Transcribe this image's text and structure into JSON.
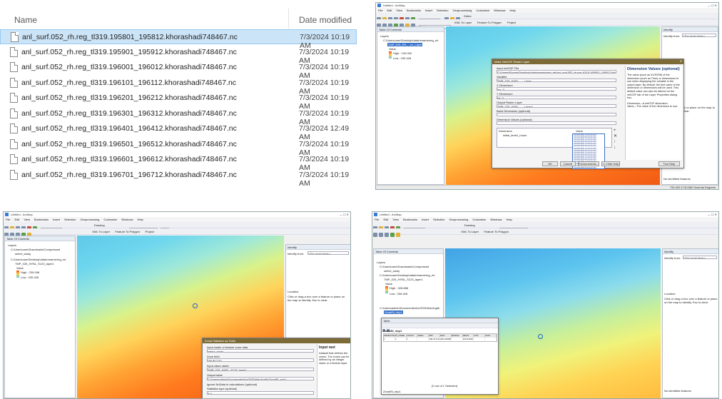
{
  "file_list": {
    "header_name": "Name",
    "header_date": "Date modified",
    "rows": [
      {
        "name": "anl_surf.052_rh.reg_tl319.195801_195812.khorashadi748467.nc",
        "date": "7/3/2024 10:19 AM",
        "selected": true
      },
      {
        "name": "anl_surf.052_rh.reg_tl319.195901_195912.khorashadi748467.nc",
        "date": "7/3/2024 10:19 AM"
      },
      {
        "name": "anl_surf.052_rh.reg_tl319.196001_196012.khorashadi748467.nc",
        "date": "7/3/2024 10:19 AM"
      },
      {
        "name": "anl_surf.052_rh.reg_tl319.196101_196112.khorashadi748467.nc",
        "date": "7/3/2024 10:19 AM"
      },
      {
        "name": "anl_surf.052_rh.reg_tl319.196201_196212.khorashadi748467.nc",
        "date": "7/3/2024 10:19 AM"
      },
      {
        "name": "anl_surf.052_rh.reg_tl319.196301_196312.khorashadi748467.nc",
        "date": "7/3/2024 10:19 AM"
      },
      {
        "name": "anl_surf.052_rh.reg_tl319.196401_196412.khorashadi748467.nc",
        "date": "7/3/2024 12:49 AM"
      },
      {
        "name": "anl_surf.052_rh.reg_tl319.196501_196512.khorashadi748467.nc",
        "date": "7/3/2024 10:19 AM"
      },
      {
        "name": "anl_surf.052_rh.reg_tl319.196601_196612.khorashadi748467.nc",
        "date": "7/3/2024 10:19 AM"
      },
      {
        "name": "anl_surf.052_rh.reg_tl319.196701_196712.khorashadi748467.nc",
        "date": "7/3/2024 10:19 AM"
      }
    ]
  },
  "arcmap_common": {
    "title": "Untitled - ArcMap",
    "menus": [
      "File",
      "Edit",
      "View",
      "Bookmarks",
      "Insert",
      "Selection",
      "Geoprocessing",
      "Customize",
      "Windows",
      "Help"
    ],
    "scale": "1:36,000,000",
    "toc_title": "Table Of Contents",
    "identify_title": "Identify",
    "identify_from_label": "Identify from:",
    "identify_from_value": "<Top-most layer>",
    "editor_label": "Editor",
    "drawing_label": "Drawing",
    "font_value": "Arial",
    "font_size": "10",
    "kml_label": "KML To Layer",
    "feature_to_polygon": "Feature To Polygon",
    "project_label": "Project"
  },
  "win_tr": {
    "toc_layers": "Layers",
    "toc_path": "C:\\Users\\user\\Desktop\\data\\rename\\reg_rel",
    "layer_name": "TMP_025_RH_...nc_Layer",
    "legend_value": "Value",
    "legend_high": "High : 100.000",
    "legend_low": "Low : 230.428",
    "dialog_title": "Make NetCDF Raster Layer",
    "dlg_fields": [
      {
        "label": "Input netCDF File",
        "value": "C:\\Users\\Khoras\\Desktop\\data\\rename\\reg_rel\\anl_surf.052_rh.reg_tl319.195801_195812.khorashadi748467.nc"
      },
      {
        "label": "Variable",
        "value": "TMP_025_HYBL_..._Layer"
      },
      {
        "label": "X Dimension",
        "value": "lon_0"
      },
      {
        "label": "Y Dimension",
        "value": "lat_0"
      },
      {
        "label": "Output Raster Layer",
        "value": "TMP_025_HYBL_..._Layer1"
      },
      {
        "label": "Band Dimension (optional)",
        "value": ""
      },
      {
        "label": "Dimension Values (optional)",
        "value": ""
      }
    ],
    "dim_header": "Dimension",
    "val_header": "Value",
    "dim_row": "initial_time0_hours",
    "dropdown_values": [
      "01/01/1958 12:00:00 AM",
      "01/01/1958 06:00:00 AM",
      "01/01/1958 12:00:00 PM",
      "01/01/1958 06:00:00 PM",
      "01/02/1958 12:00:00 AM",
      "01/02/1958 06:00:00 AM",
      "01/02/1958 12:00:00 PM",
      "01/02/1958 06:00:00 PM",
      "01/03/1958 12:00:00 AM",
      "01/03/1958 06:00:00 AM",
      "01/03/1958 12:00:00 PM",
      "01/03/1958 06:00:00 PM",
      "01/04/1958 12:00:00 AM",
      "01/04/1958 06:00:00 AM",
      "01/04/1958 12:00:00 PM",
      "01/04/1958 06:00:00 PM"
    ],
    "ok": "OK",
    "cancel": "Cancel",
    "environments": "Environments...",
    "hide_help": "<< Hide Help",
    "tool_help": "Tool Help",
    "help_title": "Dimension Values (optional)",
    "help_text": "The value (such as 01/30/05) of the dimension (such as Time) or dimensions to use when displaying the variable in the output layer. By default, the first value of the dimension or dimensions will be used. This default value can also be altered on the netCDF tab of the Layer Properties dialog box.",
    "help_bullet1": "Dimension—A netCDF dimension.",
    "help_bullet2": "Value—The value of the dimension to use.",
    "identify_text": "Click on a feature or place on the map to identify. Esc to clear.",
    "no_identified": "No identified features",
    "status_coords": "733.493  1740.862 Decimal Degrees"
  },
  "win_bl": {
    "toc_layers": "Layers",
    "toc_path1": "C:\\Users\\user\\Downloads\\Compressed",
    "toc_item1": "select_study",
    "toc_path2": "C:\\Users\\user\\Desktop\\data\\rename\\reg_rel",
    "layer_name": "TMP_025_HYBL_S123_layer1",
    "legend_value": "Value",
    "legend_high": "High : 239.948",
    "legend_low": "Low : 230.428",
    "identify_location": "Location:",
    "identify_text": "Click or drag a box over a feature or place on the map to identify. Esc to clear.",
    "dialog_title": "Zonal Statistics as Table",
    "dlg_fields": [
      {
        "label": "Input raster or feature zone data",
        "value": "select_study"
      },
      {
        "label": "Zone field",
        "value": "OBJECTID"
      },
      {
        "label": "Input value raster",
        "value": "TMP_025_HYBL_S123_layer1"
      },
      {
        "label": "Output table",
        "value": "C:\\Users\\admin\\Documents\\ArcGIS\\Default.gdb\\ZonalSt_shp1"
      }
    ],
    "ignore_nodata": "Ignore NoData in calculations (optional)",
    "stat_type_label": "Statistics type (optional)",
    "stat_type_value": "ALL",
    "help_title": "Input rast",
    "help_text": "Dataset that defines the zones. The zones can be defined by an integer raster or a feature layer."
  },
  "win_br": {
    "toc_layers": "Layers",
    "toc_path1": "C:\\Users\\user\\Downloads\\Compressed",
    "toc_item1": "select_study",
    "toc_path2": "C:\\Users\\user\\Desktop\\data\\rename\\reg_rel",
    "layer_name": "TMP_025_HYBL_S123_layer1",
    "legend_value": "Value",
    "legend_high": "High : 328.888",
    "legend_low": "Low : 206.428",
    "toc_path3": "C:\\Users\\admin\\Documents\\ArcGIS\\Default.gdb",
    "zonal_table": "ZonalSt_shp1",
    "table_title": "Table",
    "table_tab": "ZonalSt_shp1",
    "table_headers": [
      "OBJECTID",
      "ID_NAME",
      "COUNT",
      "AREA",
      "MIN",
      "MAX",
      "RANGE",
      "MEAN",
      "STD",
      "SUM"
    ],
    "table_row": [
      "1",
      "1",
      "4",
      "",
      "238.977148",
      "283.918388",
      "",
      "263.918388",
      "",
      ""
    ],
    "table_footer": "(0 out of 1 Selected)",
    "table_bottom_tab": "ZonalSt_shp1",
    "identify_location": "Location:",
    "identify_text": "Click or drag a box over a feature or place on the map to identify. Esc to clear.",
    "no_identified": "No identified features"
  }
}
